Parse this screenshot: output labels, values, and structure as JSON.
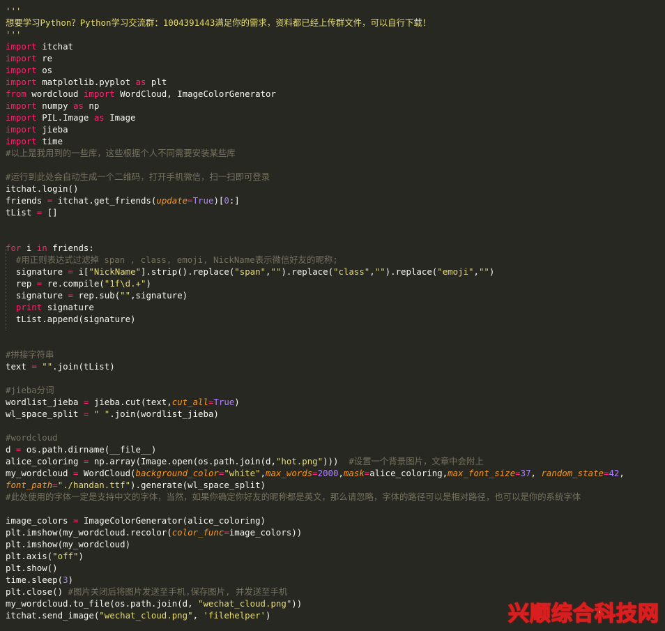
{
  "code_lines": [
    [
      [
        "str",
        "'''"
      ]
    ],
    [
      [
        "str",
        "想要学习Python？Python学习交流群：1004391443满足你的需求，资料都已经上传群文件，可以自行下载！"
      ]
    ],
    [
      [
        "str",
        "'''"
      ]
    ],
    [
      [
        "kw",
        "import"
      ],
      [
        "plain",
        " itchat"
      ]
    ],
    [
      [
        "kw",
        "import"
      ],
      [
        "plain",
        " re"
      ]
    ],
    [
      [
        "kw",
        "import"
      ],
      [
        "plain",
        " os"
      ]
    ],
    [
      [
        "kw",
        "import"
      ],
      [
        "plain",
        " matplotlib.pyplot "
      ],
      [
        "kw",
        "as"
      ],
      [
        "plain",
        " plt"
      ]
    ],
    [
      [
        "kw",
        "from"
      ],
      [
        "plain",
        " wordcloud "
      ],
      [
        "kw",
        "import"
      ],
      [
        "plain",
        " WordCloud, ImageColorGenerator"
      ]
    ],
    [
      [
        "kw",
        "import"
      ],
      [
        "plain",
        " numpy "
      ],
      [
        "kw",
        "as"
      ],
      [
        "plain",
        " np"
      ]
    ],
    [
      [
        "kw",
        "import"
      ],
      [
        "plain",
        " PIL.Image "
      ],
      [
        "kw",
        "as"
      ],
      [
        "plain",
        " Image"
      ]
    ],
    [
      [
        "kw",
        "import"
      ],
      [
        "plain",
        " jieba"
      ]
    ],
    [
      [
        "kw",
        "import"
      ],
      [
        "plain",
        " time"
      ]
    ],
    [
      [
        "cmt",
        "#以上是我用到的一些库，这些根据个人不同需要安装某些库"
      ]
    ],
    [],
    [
      [
        "cmt",
        "#运行到此处会自动生成一个二维码，打开手机微信，扫一扫即可登录"
      ]
    ],
    [
      [
        "plain",
        "itchat.login()"
      ]
    ],
    [
      [
        "plain",
        "friends "
      ],
      [
        "op",
        "="
      ],
      [
        "plain",
        " itchat.get_friends("
      ],
      [
        "param",
        "update"
      ],
      [
        "op",
        "="
      ],
      [
        "const",
        "True"
      ],
      [
        "plain",
        ")["
      ],
      [
        "num",
        "0"
      ],
      [
        "plain",
        ":]"
      ]
    ],
    [
      [
        "plain",
        "tList "
      ],
      [
        "op",
        "="
      ],
      [
        "plain",
        " []"
      ]
    ],
    [],
    [],
    [
      [
        "kw",
        "for"
      ],
      [
        "plain",
        " i "
      ],
      [
        "kw",
        "in"
      ],
      [
        "plain",
        " friends:"
      ]
    ],
    [
      [
        "plain",
        "  "
      ],
      [
        "cmt",
        "#用正则表达式过滤掉 span , class, emoji, NickName表示微信好友的昵称;"
      ]
    ],
    [
      [
        "plain",
        "  signature "
      ],
      [
        "op",
        "="
      ],
      [
        "plain",
        " i["
      ],
      [
        "str",
        "\"NickName\""
      ],
      [
        "plain",
        "].strip().replace("
      ],
      [
        "str",
        "\"span\""
      ],
      [
        "plain",
        ","
      ],
      [
        "str",
        "\"\""
      ],
      [
        "plain",
        ").replace("
      ],
      [
        "str",
        "\"class\""
      ],
      [
        "plain",
        ","
      ],
      [
        "str",
        "\"\""
      ],
      [
        "plain",
        ").replace("
      ],
      [
        "str",
        "\"emoji\""
      ],
      [
        "plain",
        ","
      ],
      [
        "str",
        "\"\""
      ],
      [
        "plain",
        ")"
      ]
    ],
    [
      [
        "plain",
        "  rep "
      ],
      [
        "op",
        "="
      ],
      [
        "plain",
        " re.compile("
      ],
      [
        "str",
        "\"1f\\d.+\""
      ],
      [
        "plain",
        ")"
      ]
    ],
    [
      [
        "plain",
        "  signature "
      ],
      [
        "op",
        "="
      ],
      [
        "plain",
        " rep.sub("
      ],
      [
        "str",
        "\"\""
      ],
      [
        "plain",
        ",signature)"
      ]
    ],
    [
      [
        "plain",
        "  "
      ],
      [
        "kw",
        "print"
      ],
      [
        "plain",
        " signature"
      ]
    ],
    [
      [
        "plain",
        "  tList.append(signature)"
      ]
    ],
    [],
    [],
    [
      [
        "cmt",
        "#拼接字符串"
      ]
    ],
    [
      [
        "plain",
        "text "
      ],
      [
        "op",
        "="
      ],
      [
        "plain",
        " "
      ],
      [
        "str",
        "\"\""
      ],
      [
        "plain",
        ".join(tList)"
      ]
    ],
    [],
    [
      [
        "cmt",
        "#jieba分词"
      ]
    ],
    [
      [
        "plain",
        "wordlist_jieba "
      ],
      [
        "op",
        "="
      ],
      [
        "plain",
        " jieba.cut(text,"
      ],
      [
        "param",
        "cut_all"
      ],
      [
        "op",
        "="
      ],
      [
        "const",
        "True"
      ],
      [
        "plain",
        ")"
      ]
    ],
    [
      [
        "plain",
        "wl_space_split "
      ],
      [
        "op",
        "="
      ],
      [
        "plain",
        " "
      ],
      [
        "str",
        "\" \""
      ],
      [
        "plain",
        ".join(wordlist_jieba)"
      ]
    ],
    [],
    [
      [
        "cmt",
        "#wordcloud"
      ]
    ],
    [
      [
        "plain",
        "d "
      ],
      [
        "op",
        "="
      ],
      [
        "plain",
        " os.path.dirname(__file__)"
      ]
    ],
    [
      [
        "plain",
        "alice_coloring "
      ],
      [
        "op",
        "="
      ],
      [
        "plain",
        " np.array(Image.open(os.path.join(d,"
      ],
      [
        "str",
        "\"hot.png\""
      ],
      [
        "plain",
        ")))  "
      ],
      [
        "cmt",
        "#设置一个背景图片，文章中会附上"
      ]
    ],
    [
      [
        "plain",
        "my_wordcloud "
      ],
      [
        "op",
        "="
      ],
      [
        "plain",
        " WordCloud("
      ],
      [
        "param",
        "background_color"
      ],
      [
        "op",
        "="
      ],
      [
        "str",
        "\"white\""
      ],
      [
        "plain",
        ","
      ],
      [
        "param",
        "max_words"
      ],
      [
        "op",
        "="
      ],
      [
        "num",
        "2000"
      ],
      [
        "plain",
        ","
      ],
      [
        "param",
        "mask"
      ],
      [
        "op",
        "="
      ],
      [
        "plain",
        "alice_coloring,"
      ],
      [
        "param",
        "max_font_size"
      ],
      [
        "op",
        "="
      ],
      [
        "num",
        "37"
      ],
      [
        "plain",
        ", "
      ],
      [
        "param",
        "random_state"
      ],
      [
        "op",
        "="
      ],
      [
        "num",
        "42"
      ],
      [
        "plain",
        ","
      ]
    ],
    [
      [
        "param",
        "font_path"
      ],
      [
        "op",
        "="
      ],
      [
        "str",
        "\"./handan.ttf\""
      ],
      [
        "plain",
        ").generate(wl_space_split)"
      ]
    ],
    [
      [
        "cmt",
        "#此处使用的字体一定是支持中文的字体，当然，如果你确定你好友的昵称都是英文，那么请忽略，字体的路径可以是相对路径，也可以是你的系统字体"
      ]
    ],
    [],
    [
      [
        "plain",
        "image_colors "
      ],
      [
        "op",
        "="
      ],
      [
        "plain",
        " ImageColorGenerator(alice_coloring)"
      ]
    ],
    [
      [
        "plain",
        "plt.imshow(my_wordcloud.recolor("
      ],
      [
        "param",
        "color_func"
      ],
      [
        "op",
        "="
      ],
      [
        "plain",
        "image_colors))"
      ]
    ],
    [
      [
        "plain",
        "plt.imshow(my_wordcloud)"
      ]
    ],
    [
      [
        "plain",
        "plt.axis("
      ],
      [
        "str",
        "\"off\""
      ],
      [
        "plain",
        ")"
      ]
    ],
    [
      [
        "plain",
        "plt.show()"
      ]
    ],
    [
      [
        "plain",
        "time.sleep("
      ],
      [
        "num",
        "3"
      ],
      [
        "plain",
        ")"
      ]
    ],
    [
      [
        "plain",
        "plt.close() "
      ],
      [
        "cmt",
        "#图片关闭后将图片发送至手机,保存图片, 并发送至手机"
      ]
    ],
    [
      [
        "plain",
        "my_wordcloud.to_file(os.path.join(d, "
      ],
      [
        "str",
        "\"wechat_cloud.png\""
      ],
      [
        "plain",
        "))"
      ]
    ],
    [
      [
        "plain",
        "itchat.send_image("
      ],
      [
        "str",
        "\"wechat_cloud.png\""
      ],
      [
        "plain",
        ", "
      ],
      [
        "str",
        "'filehelper'"
      ],
      [
        "plain",
        ")"
      ]
    ]
  ],
  "watermark": "兴顺综合科技网",
  "colors": {
    "background": "#272822",
    "keyword": "#f92672",
    "string": "#e6db74",
    "number": "#ae81ff",
    "comment": "#75715e",
    "parameter": "#fd971f",
    "text": "#f8f8f2"
  }
}
